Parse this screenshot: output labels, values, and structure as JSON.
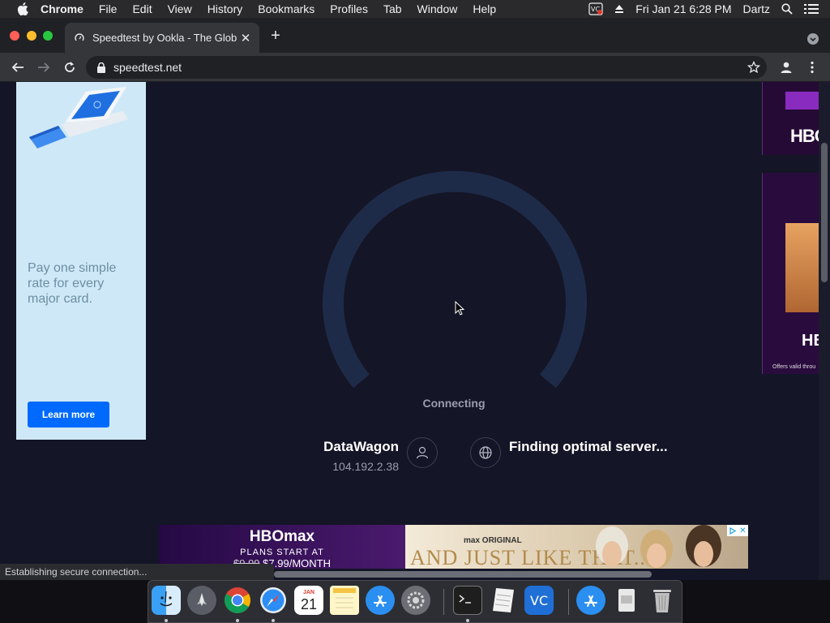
{
  "menubar": {
    "items": [
      "Chrome",
      "File",
      "Edit",
      "View",
      "History",
      "Bookmarks",
      "Profiles",
      "Tab",
      "Window",
      "Help"
    ],
    "clock": "Fri Jan 21  6:28 PM",
    "user": "Dartz"
  },
  "browser": {
    "tab_title": "Speedtest by Ookla - The Glob",
    "url": "speedtest.net",
    "status_text": "Establishing secure connection..."
  },
  "ad_left": {
    "copy": "Pay one simple rate for every major card.",
    "button": "Learn more"
  },
  "speedtest": {
    "state": "Connecting",
    "isp_name": "DataWagon",
    "isp_ip": "104.192.2.38",
    "server_status": "Finding optimal server..."
  },
  "ad_bottom": {
    "brand": "HBOmax",
    "plans": "PLANS START AT",
    "old_price": "$9.99",
    "price": "$7.99/MONTH",
    "max_original": "max ORIGINAL",
    "show_title": "AND JUST LIKE THAT..."
  },
  "ad_right": {
    "brand": "HBO",
    "fine_print": "Offers valid throu"
  },
  "dock": {
    "calendar_month": "JAN",
    "calendar_day": "21"
  },
  "colors": {
    "page_bg": "#141526",
    "gauge_arc": "#1e2b48",
    "learn_more": "#006aff"
  }
}
